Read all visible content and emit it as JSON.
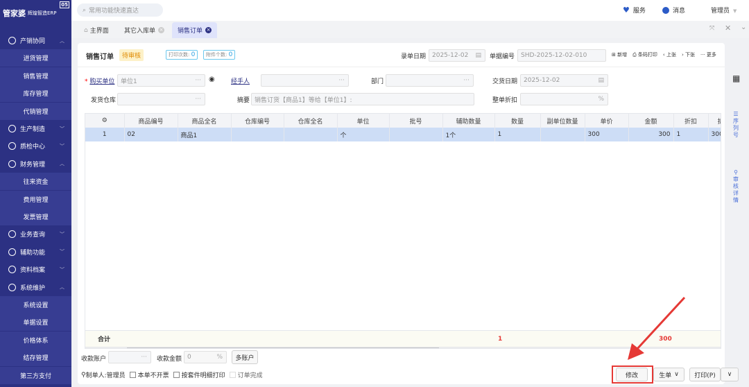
{
  "app": {
    "logo": "管家婆",
    "logo_sub": "辉煌智造ERP",
    "badge": "05"
  },
  "search": {
    "placeholder": "常用功能快速直达"
  },
  "header": {
    "service": "服务",
    "messages": "消息",
    "user": "管理员"
  },
  "sidebar": [
    {
      "label": "产销协同",
      "type": "group",
      "expanded": true
    },
    {
      "label": "进货管理",
      "type": "sub"
    },
    {
      "label": "销售管理",
      "type": "sub"
    },
    {
      "label": "库存管理",
      "type": "sub"
    },
    {
      "label": "代销管理",
      "type": "sub"
    },
    {
      "label": "生产制造",
      "type": "group"
    },
    {
      "label": "质检中心",
      "type": "group"
    },
    {
      "label": "财务管理",
      "type": "group",
      "expanded": true
    },
    {
      "label": "往来资金",
      "type": "sub"
    },
    {
      "label": "费用管理",
      "type": "sub"
    },
    {
      "label": "发票管理",
      "type": "sub"
    },
    {
      "label": "业务查询",
      "type": "group"
    },
    {
      "label": "辅助功能",
      "type": "group"
    },
    {
      "label": "资料档案",
      "type": "group"
    },
    {
      "label": "系统维护",
      "type": "group",
      "expanded": true
    },
    {
      "label": "系统设置",
      "type": "sub"
    },
    {
      "label": "单据设置",
      "type": "sub"
    },
    {
      "label": "价格体系",
      "type": "sub"
    },
    {
      "label": "结存管理",
      "type": "sub"
    },
    {
      "label": "第三方支付",
      "type": "sub"
    }
  ],
  "tabs": [
    {
      "label": "主界面"
    },
    {
      "label": "其它入库单"
    },
    {
      "label": "销售订单",
      "active": true
    }
  ],
  "doc": {
    "title": "销售订单",
    "status": "待审核",
    "print_count_label": "打印次数:",
    "print_count": "0",
    "attach_label": "附件个数:",
    "attach_count": "0",
    "entry_date_label": "录单日期",
    "entry_date": "2025-12-02",
    "number_label": "单据编号",
    "number": "SHD-2025-12-02-010",
    "actions": [
      "新增",
      "条码打印",
      "上张",
      "下张",
      "更多"
    ],
    "buyer_label": "购买单位",
    "buyer": "单位1",
    "handler_label": "经手人",
    "dept_label": "部门",
    "delivery_date_label": "交货日期",
    "delivery_date": "2025-12-02",
    "warehouse_label": "发货仓库",
    "summary_label": "摘要",
    "summary": "销售订货【商品1】等给【单位1】:",
    "discount_label": "整单折扣",
    "discount_unit": "%"
  },
  "table": {
    "columns": [
      "商品编号",
      "商品全名",
      "仓库编号",
      "仓库全名",
      "单位",
      "批号",
      "辅助数量",
      "数量",
      "副单位数量",
      "单价",
      "金额",
      "折扣",
      "折"
    ],
    "rows": [
      [
        "1",
        "02",
        "商品1",
        "",
        "",
        "个",
        "",
        "1个",
        "1",
        "",
        "300",
        "300",
        "1",
        "300"
      ]
    ],
    "total_label": "合计",
    "total_qty": "1",
    "total_amount": "300"
  },
  "side_tabs": [
    "序列号",
    "审核详情"
  ],
  "footer": {
    "account_label": "收款账户",
    "amount_label": "收款金额",
    "amount": "0",
    "amount_unit": "%",
    "multi": "多账户",
    "maker": "制单人:管理员",
    "no_invoice": "本单不开票",
    "print_by_set": "按套件明细打印",
    "order_done": "订单完成",
    "modify": "修改",
    "generate": "生单",
    "print": "打印(P)"
  },
  "colors": {
    "sidebar": "#2c3183",
    "accent": "#2c3183",
    "highlight": "#e53935",
    "selected_row": "#cdddf6"
  }
}
